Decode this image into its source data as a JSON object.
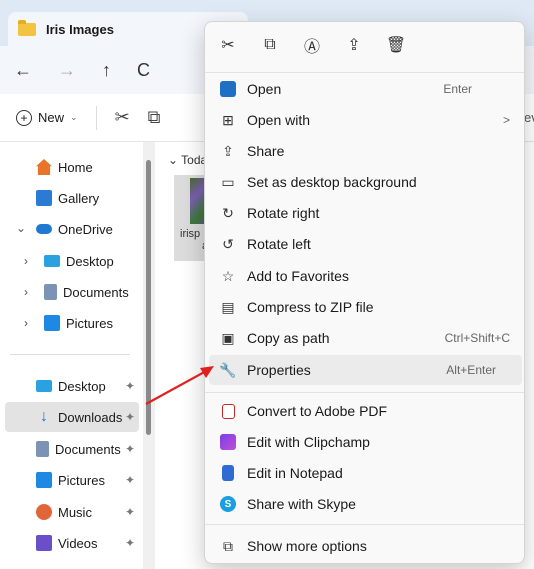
{
  "window": {
    "tab_title": "Iris Images"
  },
  "navbar": {
    "back": "←",
    "forward": "→",
    "up": "↑",
    "refresh": "C"
  },
  "toolbar": {
    "new_label": "New",
    "trailing": "ev"
  },
  "sidebar": {
    "items": [
      {
        "label": "Home"
      },
      {
        "label": "Gallery"
      },
      {
        "label": "OneDrive"
      },
      {
        "label": "Desktop"
      },
      {
        "label": "Documents"
      },
      {
        "label": "Pictures"
      }
    ],
    "pinned": [
      {
        "label": "Desktop"
      },
      {
        "label": "Downloads"
      },
      {
        "label": "Documents"
      },
      {
        "label": "Pictures"
      },
      {
        "label": "Music"
      },
      {
        "label": "Videos"
      }
    ]
  },
  "main": {
    "group_label": "Toda",
    "file_label_1": "irisp",
    "file_label_2": "a"
  },
  "context_menu": {
    "items": [
      {
        "label": "Open",
        "shortcut": "Enter",
        "icon": "open-icon"
      },
      {
        "label": "Open with",
        "shortcut": ">",
        "icon": "open-with-icon"
      },
      {
        "label": "Share",
        "shortcut": "",
        "icon": "share-icon"
      },
      {
        "label": "Set as desktop background",
        "shortcut": "",
        "icon": "desktop-background-icon"
      },
      {
        "label": "Rotate right",
        "shortcut": "",
        "icon": "rotate-right-icon"
      },
      {
        "label": "Rotate left",
        "shortcut": "",
        "icon": "rotate-left-icon"
      },
      {
        "label": "Add to Favorites",
        "shortcut": "",
        "icon": "star-icon"
      },
      {
        "label": "Compress to ZIP file",
        "shortcut": "",
        "icon": "zip-icon"
      },
      {
        "label": "Copy as path",
        "shortcut": "Ctrl+Shift+C",
        "icon": "copy-path-icon"
      },
      {
        "label": "Properties",
        "shortcut": "Alt+Enter",
        "icon": "wrench-icon"
      }
    ],
    "extra_items": [
      {
        "label": "Convert to Adobe PDF",
        "icon": "adobe-pdf-icon"
      },
      {
        "label": "Edit with Clipchamp",
        "icon": "clipchamp-icon"
      },
      {
        "label": "Edit in Notepad",
        "icon": "notepad-icon"
      },
      {
        "label": "Share with Skype",
        "icon": "skype-icon"
      }
    ],
    "more_options": {
      "label": "Show more options",
      "icon": "more-options-icon"
    }
  },
  "colors": {
    "accent": "#1f78d1",
    "arrow": "#e02020",
    "highlight": "#ebebeb"
  }
}
